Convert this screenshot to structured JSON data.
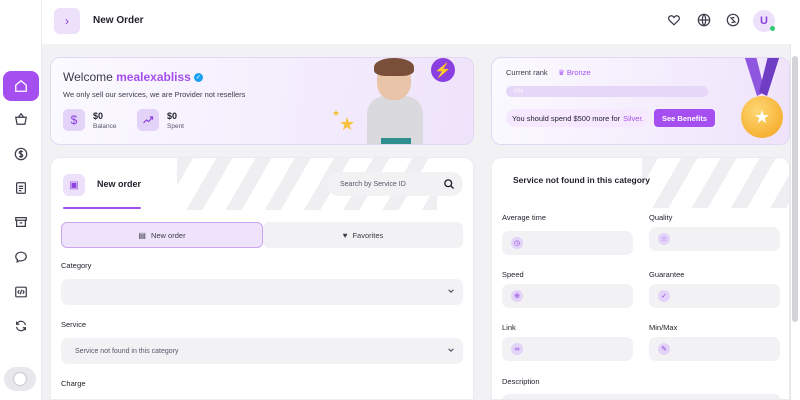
{
  "header": {
    "title": "New Order",
    "avatar_initial": "U"
  },
  "sidebar": {
    "items": [
      {
        "name": "home-icon",
        "active": true
      },
      {
        "name": "basket-icon",
        "active": false
      },
      {
        "name": "dollar-icon",
        "active": false
      },
      {
        "name": "orders-icon",
        "active": false
      },
      {
        "name": "archive-icon",
        "active": false
      },
      {
        "name": "chat-icon",
        "active": false
      },
      {
        "name": "code-icon",
        "active": false
      },
      {
        "name": "refresh-icon",
        "active": false
      }
    ]
  },
  "welcome": {
    "greeting": "Welcome",
    "username": "mealexabliss",
    "subtitle": "We only sell our services, we are Provider not resellers",
    "balance_value": "$0",
    "balance_label": "Balance",
    "spent_value": "$0",
    "spent_label": "Spent"
  },
  "rank": {
    "label": "Current rank",
    "rank_name": "Bronze",
    "progress_text": "0%",
    "progress": 0,
    "message": "You should spend $500 more for",
    "next_rank": "Silver.",
    "benefits_label": "See Benefits"
  },
  "order": {
    "title": "New order",
    "search_placeholder": "Search by Service ID",
    "tab_new": "New order",
    "tab_favorites": "Favorites",
    "category_label": "Category",
    "category_value": "",
    "service_label": "Service",
    "service_value": "Service not found in this category",
    "charge_label": "Charge"
  },
  "service_info": {
    "title": "Service not found in this category",
    "average_time_label": "Average time",
    "quality_label": "Quality",
    "speed_label": "Speed",
    "guarantee_label": "Guarantee",
    "link_label": "Link",
    "minmax_label": "Min/Max",
    "description_label": "Description"
  },
  "colors": {
    "accent": "#a64ff0",
    "accent_light": "#ece0fb",
    "field_bg": "#f2f2f4",
    "medal": "#f2a21b"
  }
}
